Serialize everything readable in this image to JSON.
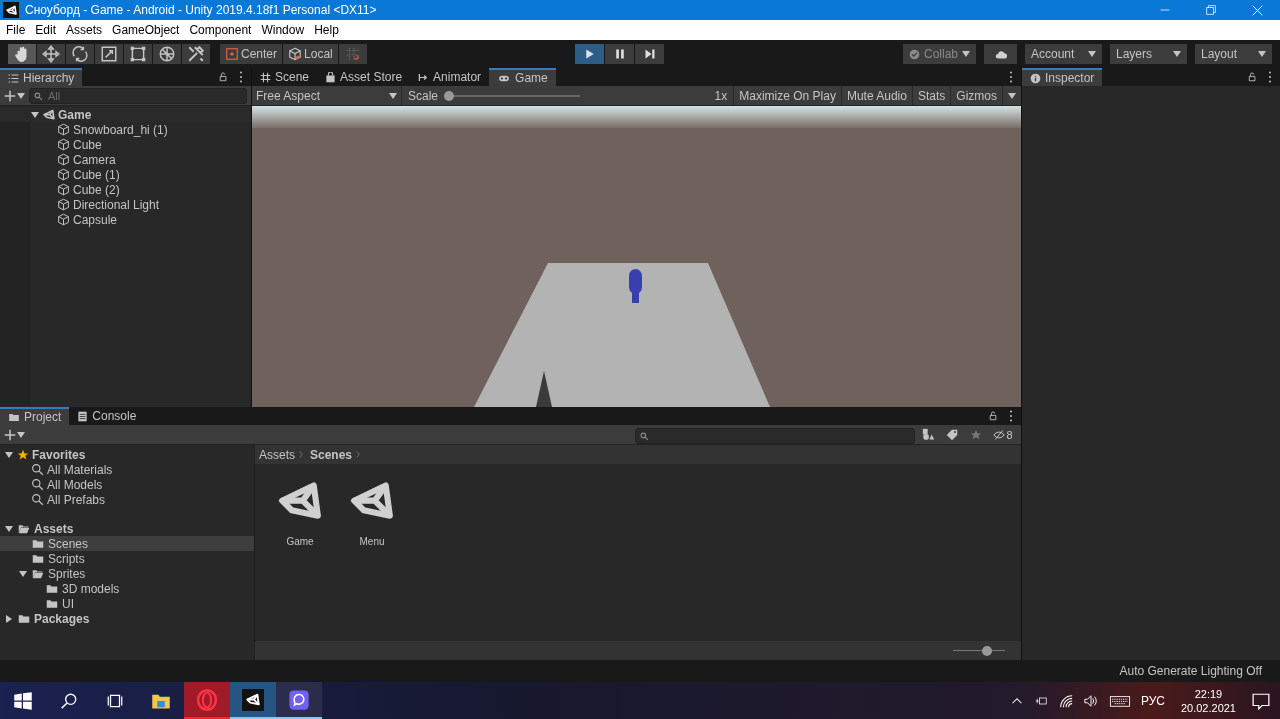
{
  "window": {
    "title": "Сноуборд - Game - Android - Unity 2019.4.18f1 Personal <DX11>"
  },
  "menu": [
    "File",
    "Edit",
    "Assets",
    "GameObject",
    "Component",
    "Window",
    "Help"
  ],
  "toolbar": {
    "tools": [
      {
        "kind": "hand",
        "selected": true
      },
      {
        "kind": "move",
        "selected": false
      },
      {
        "kind": "rotate",
        "selected": false
      },
      {
        "kind": "scale",
        "selected": false
      },
      {
        "kind": "rect",
        "selected": false
      },
      {
        "kind": "transform",
        "selected": false
      },
      {
        "kind": "custom",
        "selected": false
      }
    ],
    "pivot": [
      {
        "kind": "center",
        "label": "Center"
      },
      {
        "kind": "local",
        "label": "Local"
      }
    ],
    "playback": [
      {
        "kind": "play",
        "selected": true
      },
      {
        "kind": "pause",
        "selected": false
      },
      {
        "kind": "step",
        "selected": false
      }
    ],
    "collab": "Collab",
    "dropdowns": [
      "Account",
      "Layers",
      "Layout"
    ]
  },
  "hierarchy": {
    "tab": "Hierarchy",
    "search": {
      "placeholder": "All"
    },
    "tree": [
      {
        "label": "Game",
        "kind": "scene",
        "expanded": true,
        "children": [
          {
            "label": "Snowboard_hi (1)",
            "kind": "object"
          },
          {
            "label": "Cube",
            "kind": "object"
          },
          {
            "label": "Camera",
            "kind": "object"
          },
          {
            "label": "Cube (1)",
            "kind": "object"
          },
          {
            "label": "Cube (2)",
            "kind": "object"
          },
          {
            "label": "Directional Light",
            "kind": "object"
          },
          {
            "label": "Capsule",
            "kind": "object"
          }
        ]
      }
    ]
  },
  "view_tabs": [
    {
      "label": "Scene",
      "kind": "scene",
      "selected": false
    },
    {
      "label": "Asset Store",
      "kind": "store",
      "selected": false
    },
    {
      "label": "Animator",
      "kind": "animator",
      "selected": false
    },
    {
      "label": "Game",
      "kind": "game",
      "selected": true
    }
  ],
  "game_toolbar": {
    "aspect": "Free Aspect",
    "scale_label": "Scale",
    "scale": {
      "level": 0
    },
    "scale_value": "1x",
    "toggles": [
      {
        "label": "Maximize On Play",
        "on": false
      },
      {
        "label": "Mute Audio",
        "on": false
      },
      {
        "label": "Stats",
        "on": false
      },
      {
        "label": "Gizmos",
        "on": false
      }
    ]
  },
  "inspector": {
    "tab": "Inspector"
  },
  "project": {
    "tabs": [
      {
        "label": "Project",
        "kind": "project",
        "selected": true
      },
      {
        "label": "Console",
        "kind": "console",
        "selected": false
      }
    ],
    "hidden_count": "8",
    "tree": [
      {
        "label": "Favorites",
        "kind": "favorites",
        "expanded": true,
        "children": [
          {
            "label": "All Materials",
            "kind": "search"
          },
          {
            "label": "All Models",
            "kind": "search"
          },
          {
            "label": "All Prefabs",
            "kind": "search"
          }
        ]
      },
      {
        "label": "Assets",
        "kind": "folder",
        "expanded": true,
        "selected": false,
        "children": [
          {
            "label": "Scenes",
            "kind": "folder",
            "selected": true
          },
          {
            "label": "Scripts",
            "kind": "folder",
            "selected": false
          },
          {
            "label": "Sprites",
            "kind": "folder",
            "expanded": true,
            "selected": false,
            "children": [
              {
                "label": "3D models",
                "kind": "folder",
                "selected": false
              },
              {
                "label": "UI",
                "kind": "folder",
                "selected": false
              }
            ]
          }
        ]
      },
      {
        "label": "Packages",
        "kind": "folder",
        "expanded": false,
        "selected": false
      }
    ],
    "breadcrumb": [
      "Assets",
      "Scenes"
    ],
    "assets": [
      {
        "label": "Game",
        "kind": "scene"
      },
      {
        "label": "Menu",
        "kind": "scene"
      }
    ],
    "icon_size": {
      "level": 0.7
    }
  },
  "status_bar": "Auto Generate Lighting Off",
  "taskbar": {
    "apps": [
      {
        "kind": "start",
        "running": false
      },
      {
        "kind": "search",
        "running": false
      },
      {
        "kind": "taskview",
        "running": false
      },
      {
        "kind": "explorer",
        "running": false
      },
      {
        "kind": "opera",
        "running": true
      },
      {
        "kind": "unity",
        "running": true
      },
      {
        "kind": "viber",
        "running": true
      }
    ],
    "language": "РУС",
    "time": "22:19",
    "date": "20.02.2021"
  }
}
